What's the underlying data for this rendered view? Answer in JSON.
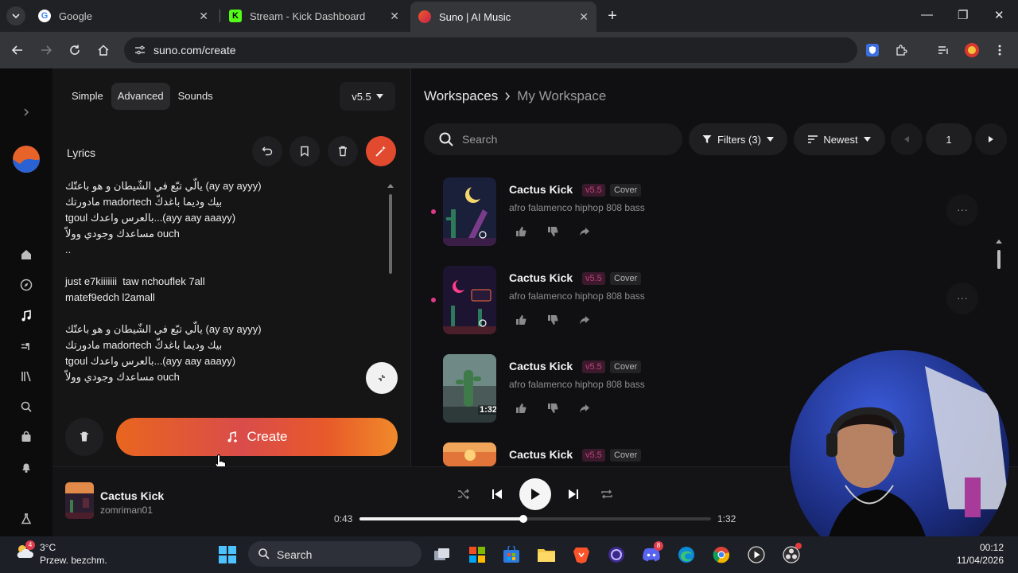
{
  "browser": {
    "tabs": [
      {
        "title": "Google"
      },
      {
        "title": "Stream - Kick Dashboard"
      },
      {
        "title": "Suno | AI Music"
      }
    ],
    "url": "suno.com/create"
  },
  "create_panel": {
    "modes": [
      "Simple",
      "Advanced",
      "Sounds"
    ],
    "selected_mode": "Advanced",
    "version": "v5.5",
    "lyrics_label": "Lyrics",
    "lyrics": [
      "يالّي تبّع في الشّيطان و هو باعتّك (ay ay ayyy)",
      "مادورتك madortech بيك وديما باغدكّ",
      "tgoul بالعرس واعدك...(ayy aay aaayy)",
      "مساعدك وجودي وولاّ ouch",
      "..",
      "",
      "just e7kiiiiiii  taw nchouflek 7all",
      "matef9edch l2amall",
      "",
      "يالّي تبّع في الشّيطان و هو باعتّك (ay ay ayyy)",
      "مادورتك madortech بيك وديما باغدكّ",
      "tgoul بالعرس واعدك...(ayy aay aaayy)",
      "مساعدك وجودي وولاّ ouch"
    ],
    "create_label": "Create"
  },
  "workspace": {
    "root": "Workspaces",
    "current": "My Workspace",
    "search_placeholder": "Search",
    "filters_label": "Filters (3)",
    "sort_label": "Newest",
    "page": "1"
  },
  "songs": [
    {
      "title": "Cactus Kick",
      "version": "v5.5",
      "tag": "Cover",
      "desc": "afro falamenco hiphop 808 bass",
      "duration": ""
    },
    {
      "title": "Cactus Kick",
      "version": "v5.5",
      "tag": "Cover",
      "desc": "afro falamenco hiphop 808 bass",
      "duration": ""
    },
    {
      "title": "Cactus Kick",
      "version": "v5.5",
      "tag": "Cover",
      "desc": "afro falamenco hiphop 808 bass",
      "duration": "1:32"
    },
    {
      "title": "Cactus Kick",
      "version": "v5.5",
      "tag": "Cover",
      "desc": "",
      "duration": ""
    }
  ],
  "player": {
    "title": "Cactus Kick",
    "artist": "zomriman01",
    "elapsed": "0:43",
    "total": "1:32",
    "progress_fraction": 0.467
  },
  "taskbar": {
    "temperature": "3°C",
    "weather": "Przew. bezchm.",
    "search_placeholder": "Search",
    "time": "00:12",
    "date": "11/04/2026",
    "weather_badge": "4",
    "discord_badge": "8"
  },
  "colors": {
    "accent_orange": "#e24a2f",
    "version_pink": "#c33f7a",
    "active_dot": "#e0398a"
  }
}
